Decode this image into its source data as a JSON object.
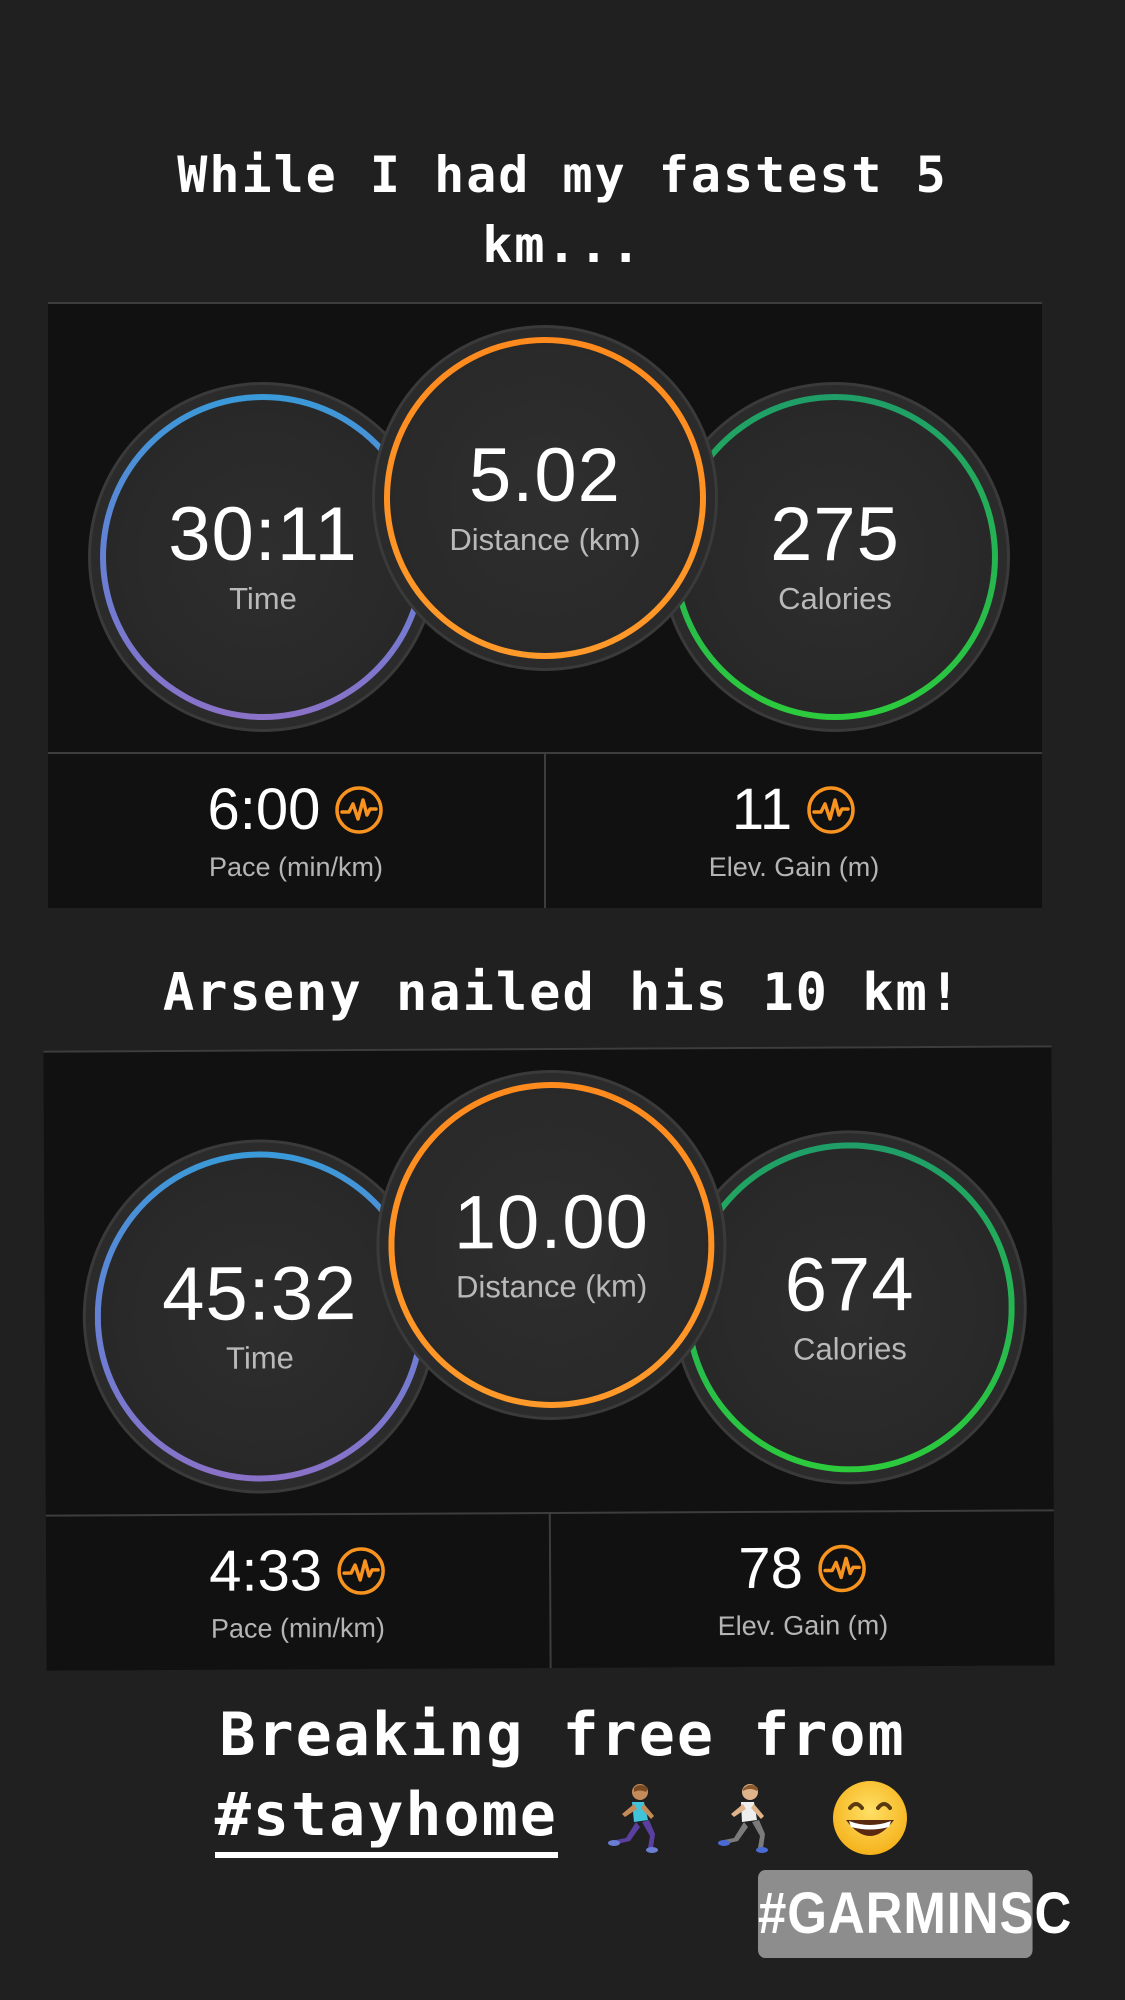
{
  "captions": {
    "top": "While I had my fastest 5 km...",
    "middle": "Arseny nailed his 10 km!",
    "bottom_line1": "Breaking free from",
    "bottom_hashtag": "#stayhome"
  },
  "activities": [
    {
      "time": {
        "value": "30:11",
        "label": "Time"
      },
      "distance": {
        "value": "5.02",
        "label": "Distance (km)"
      },
      "calories": {
        "value": "275",
        "label": "Calories"
      },
      "pace": {
        "value": "6:00",
        "label": "Pace (min/km)"
      },
      "elevation": {
        "value": "11",
        "label": "Elev. Gain (m)"
      }
    },
    {
      "time": {
        "value": "45:32",
        "label": "Time"
      },
      "distance": {
        "value": "10.00",
        "label": "Distance (km)"
      },
      "calories": {
        "value": "674",
        "label": "Calories"
      },
      "pace": {
        "value": "4:33",
        "label": "Pace (min/km)"
      },
      "elevation": {
        "value": "78",
        "label": "Elev. Gain (m)"
      }
    }
  ],
  "tag_badge": "#GARMINSC",
  "icons": {
    "stat_icon": "pulse-icon",
    "emojis": [
      "woman-running-emoji",
      "man-running-emoji",
      "grinning-face-emoji"
    ]
  },
  "colors": {
    "time_ring": "#3a9ad9",
    "distance_ring": "#ff8a1e",
    "calories_ring": "#2ccb3c",
    "pulse_icon": "#f7931e"
  }
}
